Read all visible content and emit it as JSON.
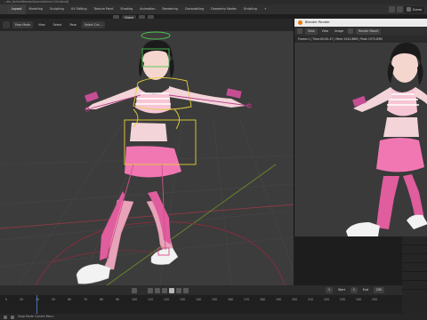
{
  "window": {
    "title": "...der_AnimeWoman\\Source\\Anime Girl.blend]"
  },
  "workspaces": [
    "Layout",
    "Modeling",
    "Sculpting",
    "UV Editing",
    "Texture Paint",
    "Shading",
    "Animation",
    "Rendering",
    "Compositing",
    "Geometry Nodes",
    "Scripting",
    "+"
  ],
  "scene": {
    "label": "Scene"
  },
  "viewport_header": {
    "mode_label": "Pose Mode",
    "menus": [
      "View",
      "Select",
      "Pose"
    ],
    "select_label": "Select Circ...",
    "orientation_label": "Global"
  },
  "render_window": {
    "title": "Blender Render",
    "menus": [
      "View",
      "View",
      "Image"
    ],
    "slot_label": "Render Result",
    "stats": "Frame:1 | Time:00:00.47 | Mem:1542.86M | Peak 1575.83M"
  },
  "timeline": {
    "current_frame": "1",
    "start_label": "Start",
    "start": "1",
    "end_label": "End",
    "end": "250",
    "ticks": [
      "0",
      "20",
      "40",
      "50",
      "60",
      "70",
      "80",
      "90",
      "100",
      "110",
      "120",
      "130",
      "140",
      "150",
      "160",
      "170",
      "180",
      "190",
      "200",
      "210",
      "220",
      "230",
      "240",
      "250"
    ]
  },
  "status": {
    "text": "Snap Mode Current Menu"
  },
  "colors": {
    "accent": "#4772b3",
    "bone_green": "#4dc74d",
    "bone_yellow": "#e6cf39",
    "bone_pink": "#b83a86"
  }
}
